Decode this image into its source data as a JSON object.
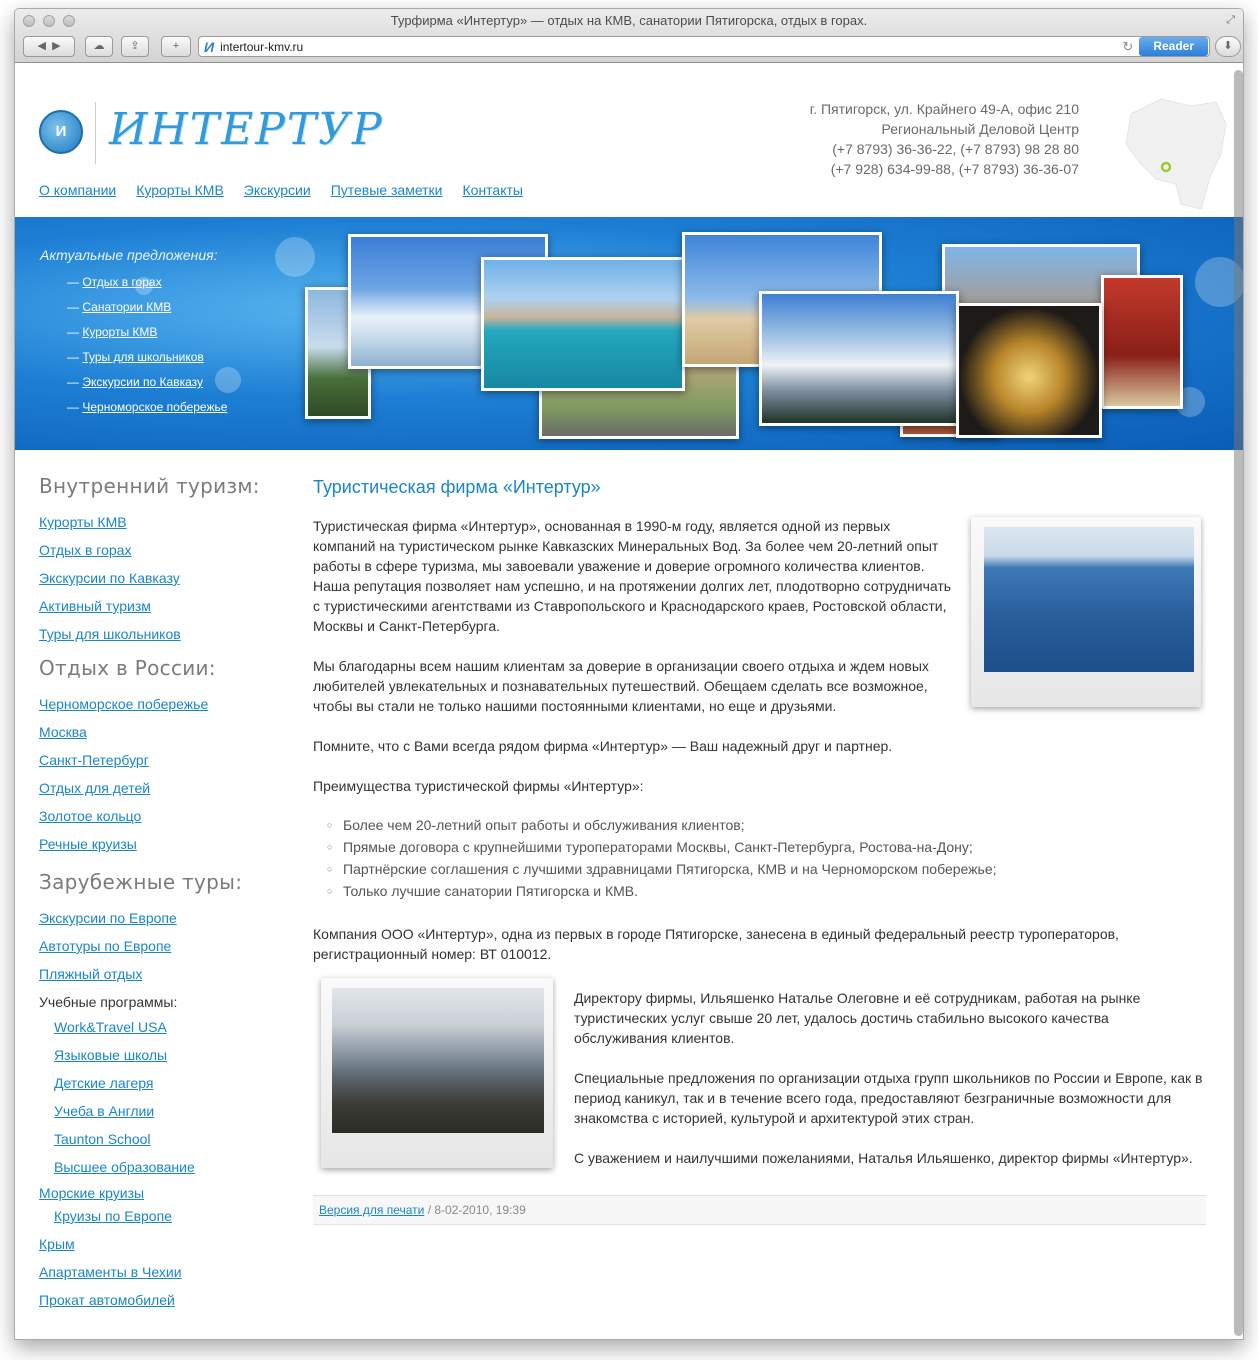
{
  "window": {
    "title": "Турфирма «Интертур» — отдых на КМВ, санатории Пятигорска, отдых в горах.",
    "url": "intertour-kmv.ru",
    "reader_label": "Reader"
  },
  "logo": {
    "text": "ИНТЕРТУР"
  },
  "contacts": [
    "г. Пятигорск, ул. Крайнего 49-А, офис 210",
    "Региональный Деловой Центр",
    "(+7 8793) 36-36-22, (+7 8793) 98 28 80",
    "(+7 928) 634-99-88, (+7 8793) 36-36-07"
  ],
  "topnav": [
    "О компании",
    "Курорты КМВ",
    "Экскурсии",
    "Путевые заметки",
    "Контакты"
  ],
  "offers": {
    "title": "Актуальные предложения:",
    "items": [
      "Отдых в горах",
      "Санатории КМВ",
      "Курорты КМВ",
      "Туры для школьников",
      "Экскурсии по Кавказу",
      "Черноморское побережье"
    ]
  },
  "sidebar": {
    "domestic": {
      "title": "Внутренний туризм:",
      "items": [
        "Курорты КМВ",
        "Отдых в горах",
        "Экскурсии по Кавказу",
        "Активный туризм",
        "Туры для школьников"
      ]
    },
    "russia": {
      "title": "Отдых в России:",
      "items": [
        "Черноморское побережье",
        "Москва",
        "Санкт-Петербург",
        "Отдых для детей",
        "Золотое кольцо",
        "Речные круизы"
      ]
    },
    "abroad": {
      "title": "Зарубежные туры:",
      "items": [
        "Экскурсии по Европе",
        "Автотуры по Европе",
        "Пляжный отдых"
      ],
      "edu_label": "Учебные программы:",
      "edu_items": [
        "Work&Travel USA",
        "Языковые школы",
        "Детские лагеря",
        "Учеба в Англии",
        "Taunton School",
        "Высшее образование"
      ],
      "cruises": "Морские круизы",
      "cruises_sub": "Круизы по Европе",
      "more": [
        "Крым",
        "Апартаменты в Чехии",
        "Прокат автомобилей"
      ]
    }
  },
  "main": {
    "title": "Туристическая фирма «Интертур»",
    "p1": "Туристическая фирма «Интертур», основанная в 1990-м году, является одной из первых компаний на туристическом рынке Кавказских Минеральных Вод. За более чем 20-летний опыт работы в сфере туризма, мы завоевали уважение и доверие огромного количества клиентов. Наша репутация позволяет нам успешно, и на протяжении долгих лет, плодотворно сотрудничать с туристическими агентствами из Ставропольского и Краснодарского краев, Ростовской области, Москвы и Санкт-Петербурга.",
    "p2": "Мы благодарны всем нашим клиентам за доверие в организации своего отдыха и ждем новых любителей увлекательных и познавательных путешествий. Обещаем сделать все возможное, чтобы вы стали не только нашими постоянными клиентами, но еще и друзьями.",
    "p3": "Помните, что с Вами всегда рядом фирма «Интертур» — Ваш надежный друг и партнер.",
    "p4": "Преимущества туристической фирмы «Интертур»:",
    "advantages": [
      "Более чем 20-летний опыт работы и обслуживания клиентов;",
      "Прямые договора с крупнейшими туроператорами Москвы, Санкт-Петербурга, Ростова-на-Дону;",
      "Партнёрские соглашения с лучшими здравницами Пятигорска, КМВ и на Черноморском побережье;",
      "Только лучшие санатории Пятигорска и КМВ."
    ],
    "p5": "Компания ООО «Интертур», одна из первых в городе Пятигорске, занесена в единый федеральный реестр туроператоров, регистрационный номер: ВТ 010012.",
    "p6": "Директору фирмы, Ильяшенко Наталье Олеговне и её сотрудникам, работая на рынке туристических услуг свыше 20 лет, удалось достичь стабильно высокого качества обслуживания клиентов.",
    "p7": "Специальные предложения по организации отдыха групп школьников по России и Европе, как в период каникул, так и в течение всего года, предоставляют безграничные возможности для знакомства с историей, культурой и архитектурой этих стран.",
    "p8": "С уважением и наилучшими пожеланиями, Наталья Ильяшенко, директор фирмы «Интертур».",
    "print_link": "Версия для печати",
    "date": "/ 8-02-2010, 19:39"
  }
}
